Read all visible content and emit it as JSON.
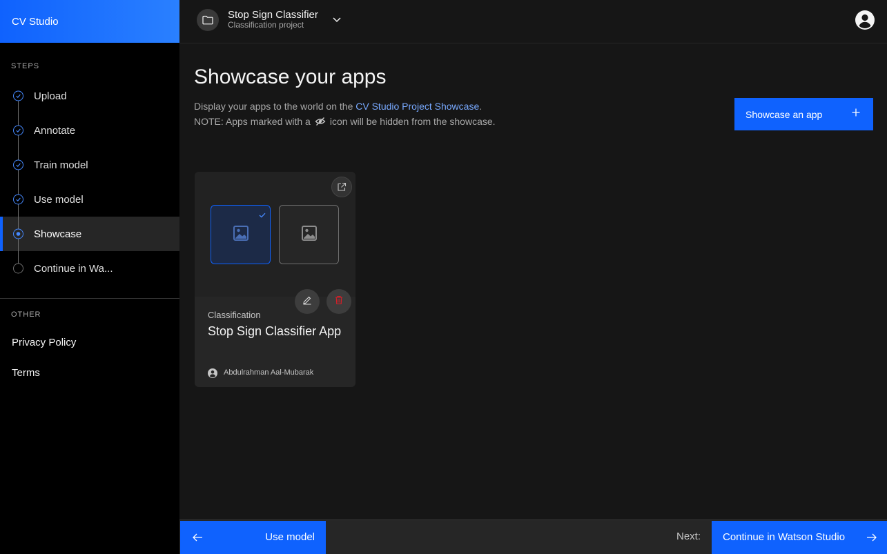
{
  "app": {
    "name": "CV Studio"
  },
  "sidebar": {
    "steps_label": "STEPS",
    "steps": [
      {
        "label": "Upload",
        "state": "done"
      },
      {
        "label": "Annotate",
        "state": "done"
      },
      {
        "label": "Train model",
        "state": "done"
      },
      {
        "label": "Use model",
        "state": "done"
      },
      {
        "label": "Showcase",
        "state": "current"
      },
      {
        "label": "Continue in Wa...",
        "state": "pending"
      }
    ],
    "other_label": "OTHER",
    "other_links": [
      {
        "label": "Privacy Policy"
      },
      {
        "label": "Terms"
      }
    ]
  },
  "topbar": {
    "project_name": "Stop Sign Classifier",
    "project_type": "Classification project",
    "icons": {
      "project": "folder-icon",
      "dropdown": "chevron-down-icon",
      "user": "user-avatar-icon"
    }
  },
  "main": {
    "title": "Showcase your apps",
    "description_prefix": "Display your apps to the world on the",
    "description_link": "CV Studio Project Showcase",
    "description_suffix": ".",
    "note_prefix": "NOTE: Apps marked with a",
    "note_suffix": "icon will be hidden from the showcase.",
    "showcase_button": "Showcase an app",
    "cards": [
      {
        "category": "Classification",
        "name": "Stop Sign Classifier App",
        "author": "Abdulrahman Aal-Mubarak"
      }
    ]
  },
  "footer": {
    "back_label": "Use model",
    "next_prefix": "Next:",
    "next_label": "Continue in Watson Studio"
  },
  "colors": {
    "accent": "#0f62fe",
    "link": "#78a9ff",
    "danger": "#da1e28",
    "background": "#161616",
    "sidebar": "#000000"
  }
}
